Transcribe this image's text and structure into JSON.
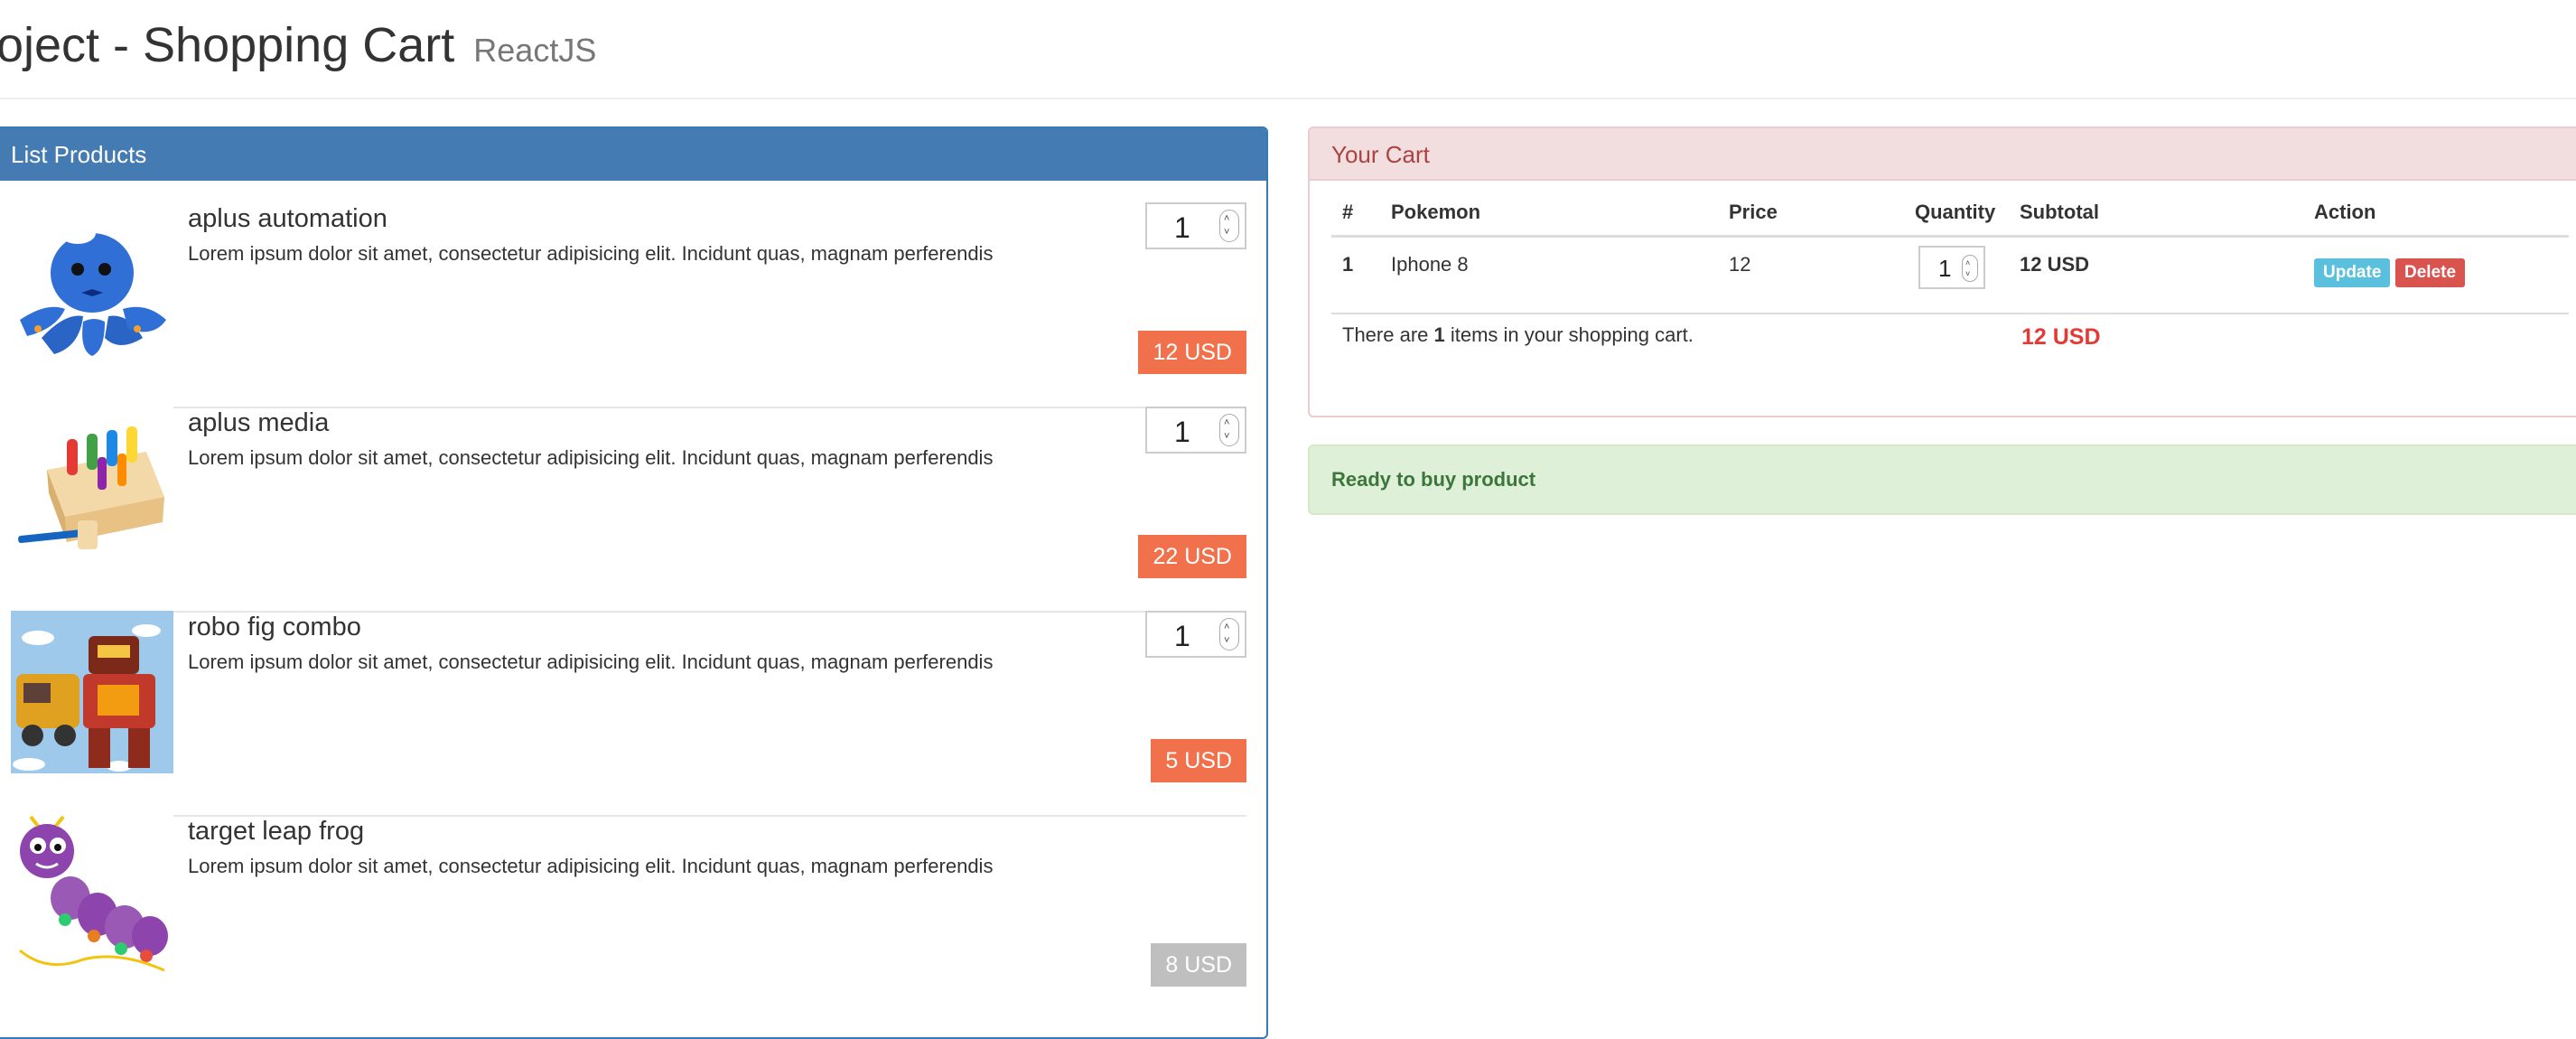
{
  "header": {
    "title": "roject - Shopping Cart",
    "subtitle": "ReactJS"
  },
  "products": {
    "heading": "List Products",
    "items": [
      {
        "name": "aplus automation",
        "description": "Lorem ipsum dolor sit amet, consectetur adipisicing elit. Incidunt quas, magnam perferendis",
        "quantity": "1",
        "price": "12 USD"
      },
      {
        "name": "aplus media",
        "description": "Lorem ipsum dolor sit amet, consectetur adipisicing elit. Incidunt quas, magnam perferendis",
        "quantity": "1",
        "price": "22 USD"
      },
      {
        "name": "robo fig combo",
        "description": "Lorem ipsum dolor sit amet, consectetur adipisicing elit. Incidunt quas, magnam perferendis",
        "quantity": "1",
        "price": "5 USD"
      },
      {
        "name": "target leap frog",
        "description": "Lorem ipsum dolor sit amet, consectetur adipisicing elit. Incidunt quas, magnam perferendis",
        "price": "8 USD"
      }
    ]
  },
  "cart": {
    "heading": "Your Cart",
    "columns": [
      "#",
      "Pokemon",
      "Price",
      "Quantity",
      "Subtotal",
      "Action"
    ],
    "rows": [
      {
        "index": "1",
        "name": "Iphone 8",
        "price": "12",
        "quantity": "1",
        "subtotal": "12 USD"
      }
    ],
    "update_label": "Update",
    "delete_label": "Delete",
    "summary_prefix": "There are ",
    "summary_count": "1",
    "summary_suffix": " items in your shopping cart.",
    "total": "12 USD"
  },
  "alert": {
    "message": "Ready to buy product"
  },
  "colors": {
    "primary": "#447bb3",
    "price_tag": "#f0714b",
    "price_tag_disabled": "#bfbfbf",
    "danger_heading_bg": "#f2dede",
    "success_bg": "#dff0d8",
    "update_button": "#5bc0de",
    "delete_button": "#d9534f",
    "total_text": "#e53935"
  },
  "icons": {
    "spinner": "number-spinner-icon"
  }
}
